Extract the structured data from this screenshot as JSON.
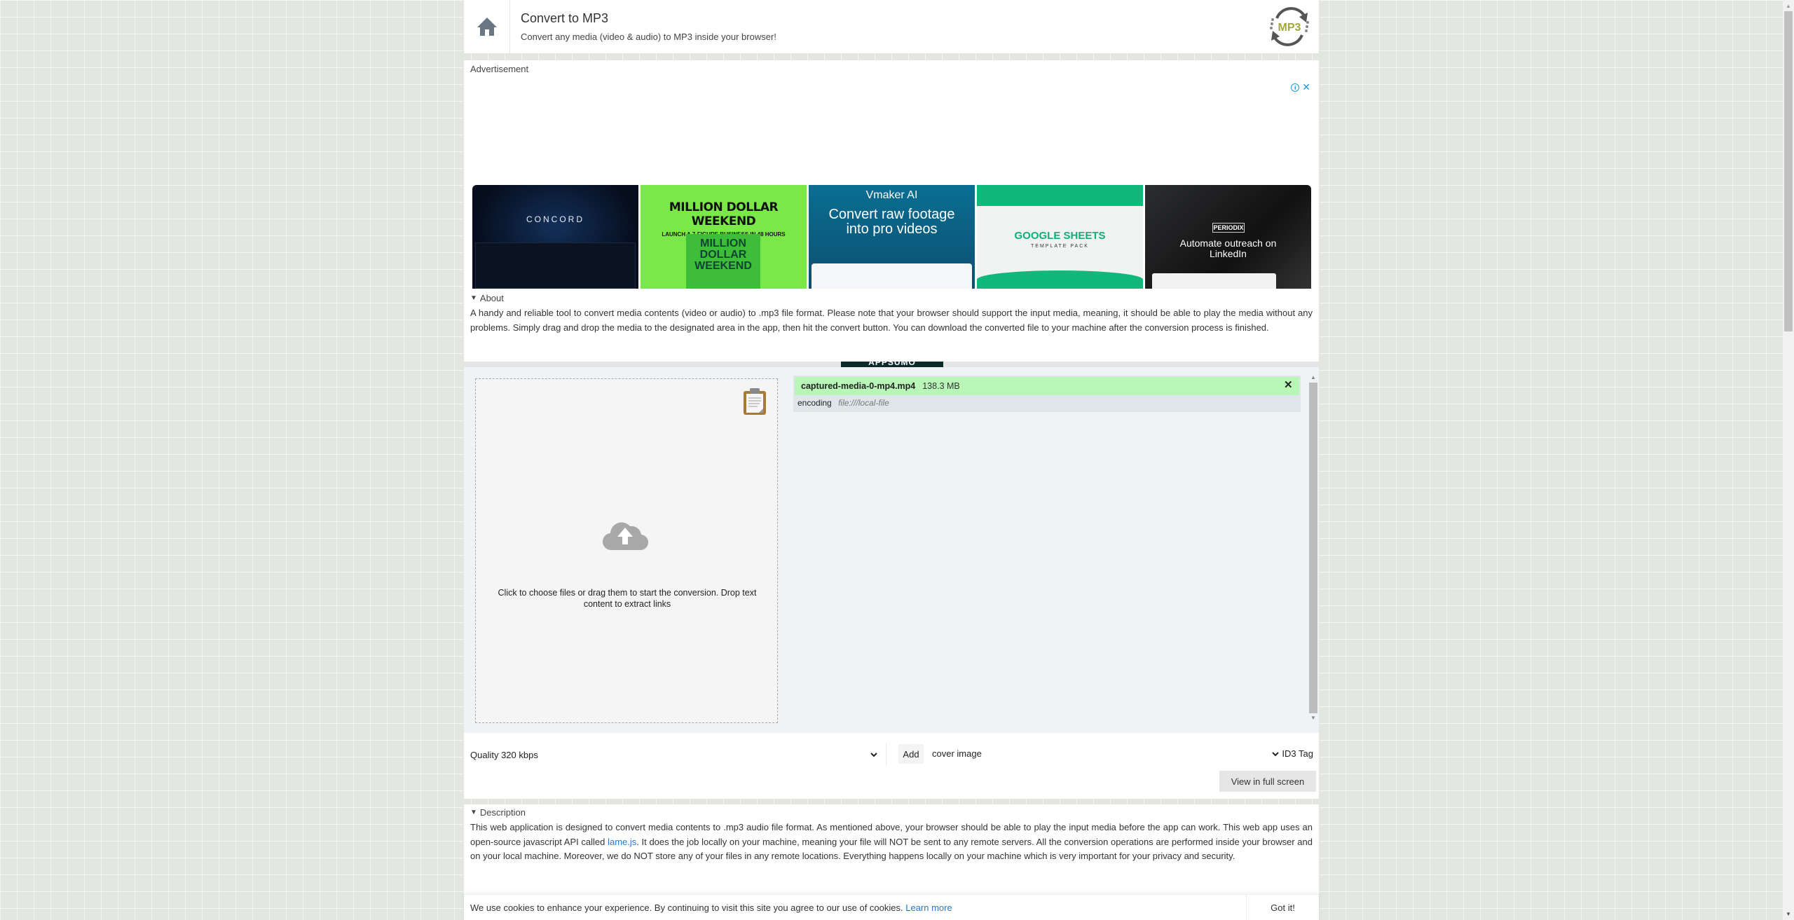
{
  "header": {
    "title": "Convert to MP3",
    "subtitle": "Convert any media (video & audio) to MP3 inside your browser!",
    "home_icon": "home-icon",
    "logo_text": "MP3",
    "logo_icon": "mp3-convert-logo"
  },
  "ad": {
    "label": "Advertisement",
    "info_glyph": "i",
    "close_glyph": "✕",
    "tiles": [
      {
        "brand": "CONCORD",
        "headline": ""
      },
      {
        "brand": "MILLION DOLLAR WEEKEND",
        "headline": "LAUNCH A 7-FIGURE BUSINESS IN 48 HOURS",
        "book": "MILLION DOLLAR WEEKEND"
      },
      {
        "brand": "Vmaker AI",
        "headline": "Convert raw footage into pro videos"
      },
      {
        "brand": "GOOGLE SHEETS",
        "headline": "TEMPLATE PACK"
      },
      {
        "brand": "PERIODIX",
        "headline": "Automate outreach on LinkedIn"
      }
    ],
    "appsumo": "APPSUMO"
  },
  "about": {
    "summary": "About",
    "text": "A handy and reliable tool to convert media contents (video or audio) to .mp3 file format. Please note that your browser should support the input media, meaning, it should be able to play the media without any problems. Simply drag and drop the media to the designated area in the app, then hit the convert button. You can download the converted file to your machine after the conversion process is finished."
  },
  "app": {
    "dropzone_text": "Click to choose files or drag them to start the conversion. Drop text content to extract links",
    "files": [
      {
        "name": "captured-media-0-mp4.mp4",
        "size": "138.3 MB",
        "status": "encoding",
        "source": "file:///local-file",
        "close_glyph": "✕"
      }
    ]
  },
  "toolbar": {
    "quality_label": "Quality 320 kbps",
    "add_label": "Add",
    "cover_label": "cover image",
    "id3_label": "ID3 Tag",
    "fullscreen_label": "View in full screen"
  },
  "description": {
    "summary": "Description",
    "text_before": "This web application is designed to convert media contents to .mp3 audio file format. As mentioned above, your browser should be able to play the input media before the app can work. This web app uses an open-source javascript API called ",
    "link": "lame.js",
    "text_after": ". It does the job locally on your machine, meaning your file will NOT be sent to any remote servers. All the conversion operations are performed inside your browser and on your local machine. Moreover, we do NOT store any of your files in any remote locations. Everything happens locally on your machine which is very important for your privacy and security."
  },
  "cookie": {
    "text": "We use cookies to enhance your experience. By continuing to visit this site you agree to our use of cookies.",
    "learn_more": "Learn more",
    "button": "Got it!"
  },
  "colors": {
    "file_row_bg": "#b8f7b8",
    "link": "#2a7ac7",
    "logo_accent": "#a0a83a"
  }
}
